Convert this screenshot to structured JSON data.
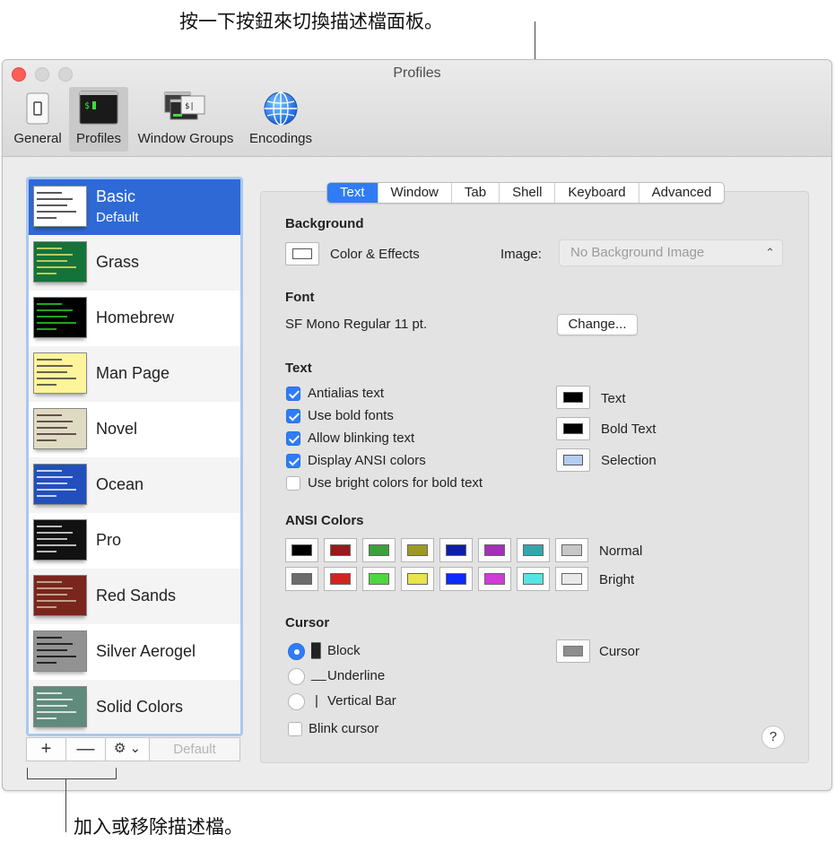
{
  "callouts": {
    "top": "按一下按鈕來切換描述檔面板。",
    "bottom": "加入或移除描述檔。"
  },
  "window": {
    "title": "Profiles",
    "toolbar": [
      {
        "label": "General",
        "icon": "general-switch-icon"
      },
      {
        "label": "Profiles",
        "icon": "terminal-profile-icon"
      },
      {
        "label": "Window Groups",
        "icon": "window-groups-icon"
      },
      {
        "label": "Encodings",
        "icon": "globe-icon"
      }
    ]
  },
  "profiles": [
    {
      "name": "Basic",
      "sub": "Default",
      "bg": "#ffffff",
      "fg": "#222222"
    },
    {
      "name": "Grass",
      "bg": "#14733a",
      "fg": "#f2e56b"
    },
    {
      "name": "Homebrew",
      "bg": "#000000",
      "fg": "#2bdc2b"
    },
    {
      "name": "Man Page",
      "bg": "#fef49c",
      "fg": "#333333"
    },
    {
      "name": "Novel",
      "bg": "#dfdbc3",
      "fg": "#3b2322"
    },
    {
      "name": "Ocean",
      "bg": "#224fbc",
      "fg": "#ffffff"
    },
    {
      "name": "Pro",
      "bg": "#111111",
      "fg": "#f2f2f2"
    },
    {
      "name": "Red Sands",
      "bg": "#7a251e",
      "fg": "#d7c9a7"
    },
    {
      "name": "Silver Aerogel",
      "bg": "#929292",
      "fg": "#000000"
    },
    {
      "name": "Solid Colors",
      "bg": "#5f8a7c",
      "fg": "#ffffff"
    }
  ],
  "list_buttons": {
    "add": "+",
    "remove": "—",
    "gear": "⚙ ⌄",
    "default": "Default"
  },
  "tabs": [
    "Text",
    "Window",
    "Tab",
    "Shell",
    "Keyboard",
    "Advanced"
  ],
  "background": {
    "heading": "Background",
    "color_effects": "Color & Effects",
    "image_label": "Image:",
    "image_value": "No Background Image"
  },
  "font": {
    "heading": "Font",
    "value": "SF Mono Regular 11 pt.",
    "change": "Change..."
  },
  "text": {
    "heading": "Text",
    "options": [
      {
        "label": "Antialias text",
        "checked": true
      },
      {
        "label": "Use bold fonts",
        "checked": true
      },
      {
        "label": "Allow blinking text",
        "checked": true
      },
      {
        "label": "Display ANSI colors",
        "checked": true
      },
      {
        "label": "Use bright colors for bold text",
        "checked": false
      }
    ],
    "colors": [
      {
        "label": "Text",
        "color": "#000000"
      },
      {
        "label": "Bold Text",
        "color": "#000000"
      },
      {
        "label": "Selection",
        "color": "#b4cdf0"
      }
    ]
  },
  "ansi": {
    "heading": "ANSI Colors",
    "normal_label": "Normal",
    "bright_label": "Bright",
    "normal": [
      "#000000",
      "#991a1a",
      "#3aa23a",
      "#9c9a22",
      "#0b1eaa",
      "#a52fb8",
      "#33a6ad",
      "#c7c7c7"
    ],
    "bright": [
      "#6b6b6b",
      "#d4231f",
      "#4dd73e",
      "#e8e44c",
      "#0b2aff",
      "#d23ad9",
      "#55e4e4",
      "#e9e9e9"
    ]
  },
  "cursor": {
    "heading": "Cursor",
    "options": [
      {
        "label": "Block",
        "glyph": "█",
        "selected": true
      },
      {
        "label": "Underline",
        "glyph": "__",
        "selected": false
      },
      {
        "label": "Vertical Bar",
        "glyph": "|",
        "selected": false
      }
    ],
    "blink": "Blink cursor",
    "color_label": "Cursor",
    "color": "#8d8d8d"
  },
  "help": "?"
}
